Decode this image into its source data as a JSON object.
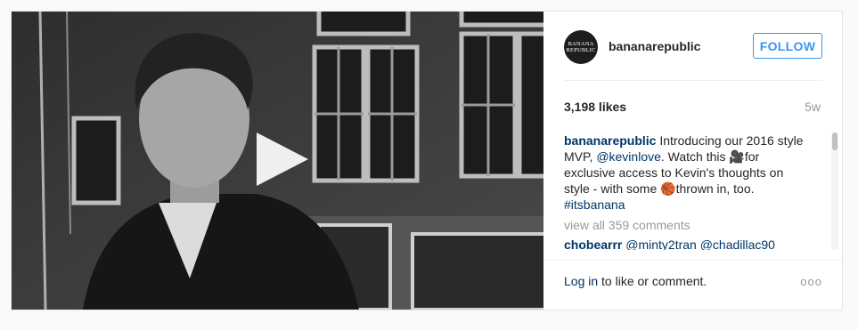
{
  "post": {
    "username": "bananarepublic",
    "avatar_text": "BANANA REPUBLIC",
    "follow_label": "FOLLOW",
    "likes": "3,198 likes",
    "time": "5w",
    "caption_user": "bananarepublic",
    "caption_part1": " Introducing our 2016 style MVP, ",
    "caption_mention": "@kevinlove",
    "caption_part2": ". Watch this ",
    "caption_part3": "for exclusive access to Kevin's thoughts on style - with some ",
    "caption_part4": "thrown in, too. ",
    "caption_hashtag": "#itsbanana",
    "camera_emoji_icon": "movie-camera-icon",
    "ball_emoji_icon": "basketball-icon",
    "view_all": "view all 359 comments",
    "comment_user": "chobearrr",
    "comment_text": " @minty2tran @chadillac90",
    "login_link": "Log in",
    "login_text": " to like or comment.",
    "more_label": "ooo"
  },
  "colors": {
    "accent": "#3897f0",
    "link": "#003569",
    "muted": "#999999"
  }
}
